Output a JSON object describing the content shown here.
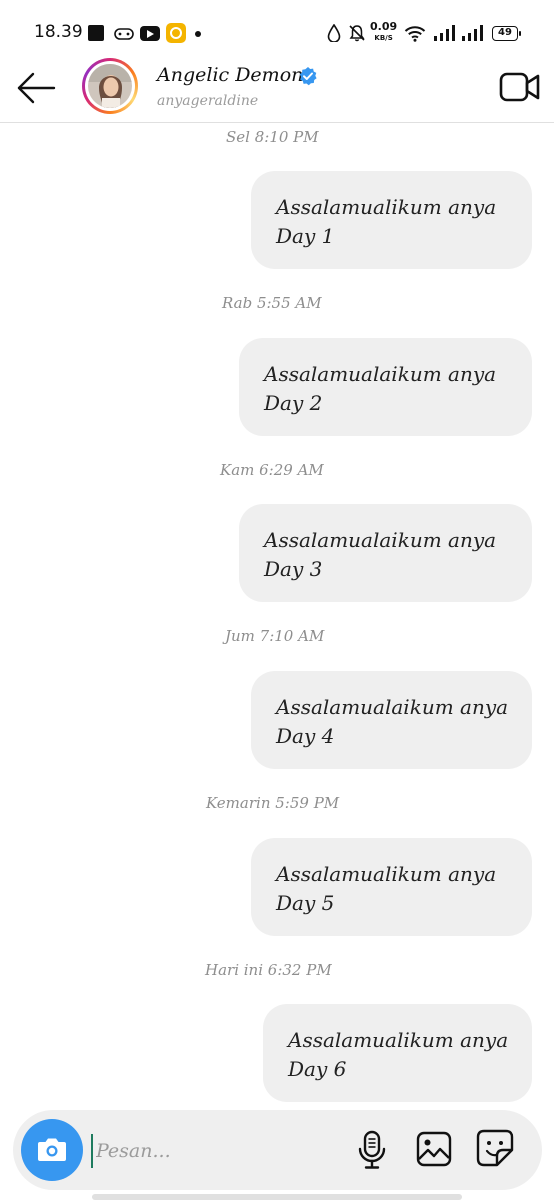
{
  "status_bar": {
    "time": "18.39",
    "net_speed_value": "0.09",
    "net_speed_unit": "KB/S",
    "battery": "49"
  },
  "header": {
    "contact_name": "Angelic Demon",
    "contact_username": "anyageraldine",
    "verified_color": "#3797f0"
  },
  "messages": [
    {
      "timestamp": "Sel 8:10 PM",
      "line1": "Assalamualikum anya",
      "line2": "Day 1"
    },
    {
      "timestamp": "Rab 5:55 AM",
      "line1": "Assalamualaikum anya",
      "line2": "Day 2"
    },
    {
      "timestamp": "Kam 6:29 AM",
      "line1": "Assalamualaikum anya",
      "line2": "Day 3"
    },
    {
      "timestamp": "Jum 7:10 AM",
      "line1": "Assalamualaikum anya",
      "line2": "Day 4"
    },
    {
      "timestamp": "Kemarin 5:59 PM",
      "line1": "Assalamualikum anya",
      "line2": "Day 5"
    },
    {
      "timestamp": "Hari ini 6:32 PM",
      "line1": "Assalamualikum anya",
      "line2": "Day 6"
    }
  ],
  "composer": {
    "placeholder": "Pesan...",
    "camera_color": "#3797f0"
  },
  "icons": {
    "back": "back-arrow-icon",
    "video": "video-call-icon",
    "camera": "camera-icon",
    "mic": "microphone-icon",
    "gallery": "gallery-icon",
    "sticker": "sticker-icon"
  }
}
